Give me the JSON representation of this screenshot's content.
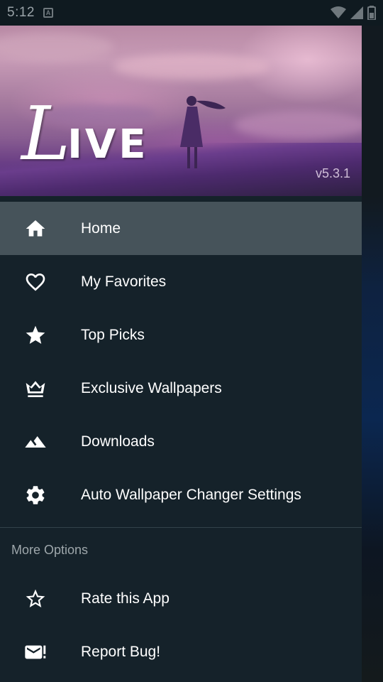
{
  "status_bar": {
    "time": "5:12",
    "icons": [
      "notification-a-icon",
      "wifi-icon",
      "signal-icon",
      "battery-icon"
    ]
  },
  "header": {
    "logo_first": "L",
    "logo_rest": "IVE",
    "version": "v5.3.1"
  },
  "menu": {
    "items": [
      {
        "label": "Home",
        "icon": "home-icon",
        "active": true
      },
      {
        "label": "My Favorites",
        "icon": "heart-outline-icon"
      },
      {
        "label": "Top Picks",
        "icon": "star-icon"
      },
      {
        "label": "Exclusive Wallpapers",
        "icon": "crown-icon"
      },
      {
        "label": "Downloads",
        "icon": "landscape-icon"
      },
      {
        "label": "Auto Wallpaper Changer Settings",
        "icon": "gear-icon"
      }
    ]
  },
  "more_options": {
    "title": "More Options",
    "items": [
      {
        "label": "Rate this App",
        "icon": "star-outline-icon"
      },
      {
        "label": "Report Bug!",
        "icon": "mail-alert-icon"
      }
    ]
  },
  "colors": {
    "drawer_bg": "#15222a",
    "active_item_bg": "#46535a",
    "section_title": "#9ea7ab",
    "status_bar_bg": "#0f1a20"
  }
}
